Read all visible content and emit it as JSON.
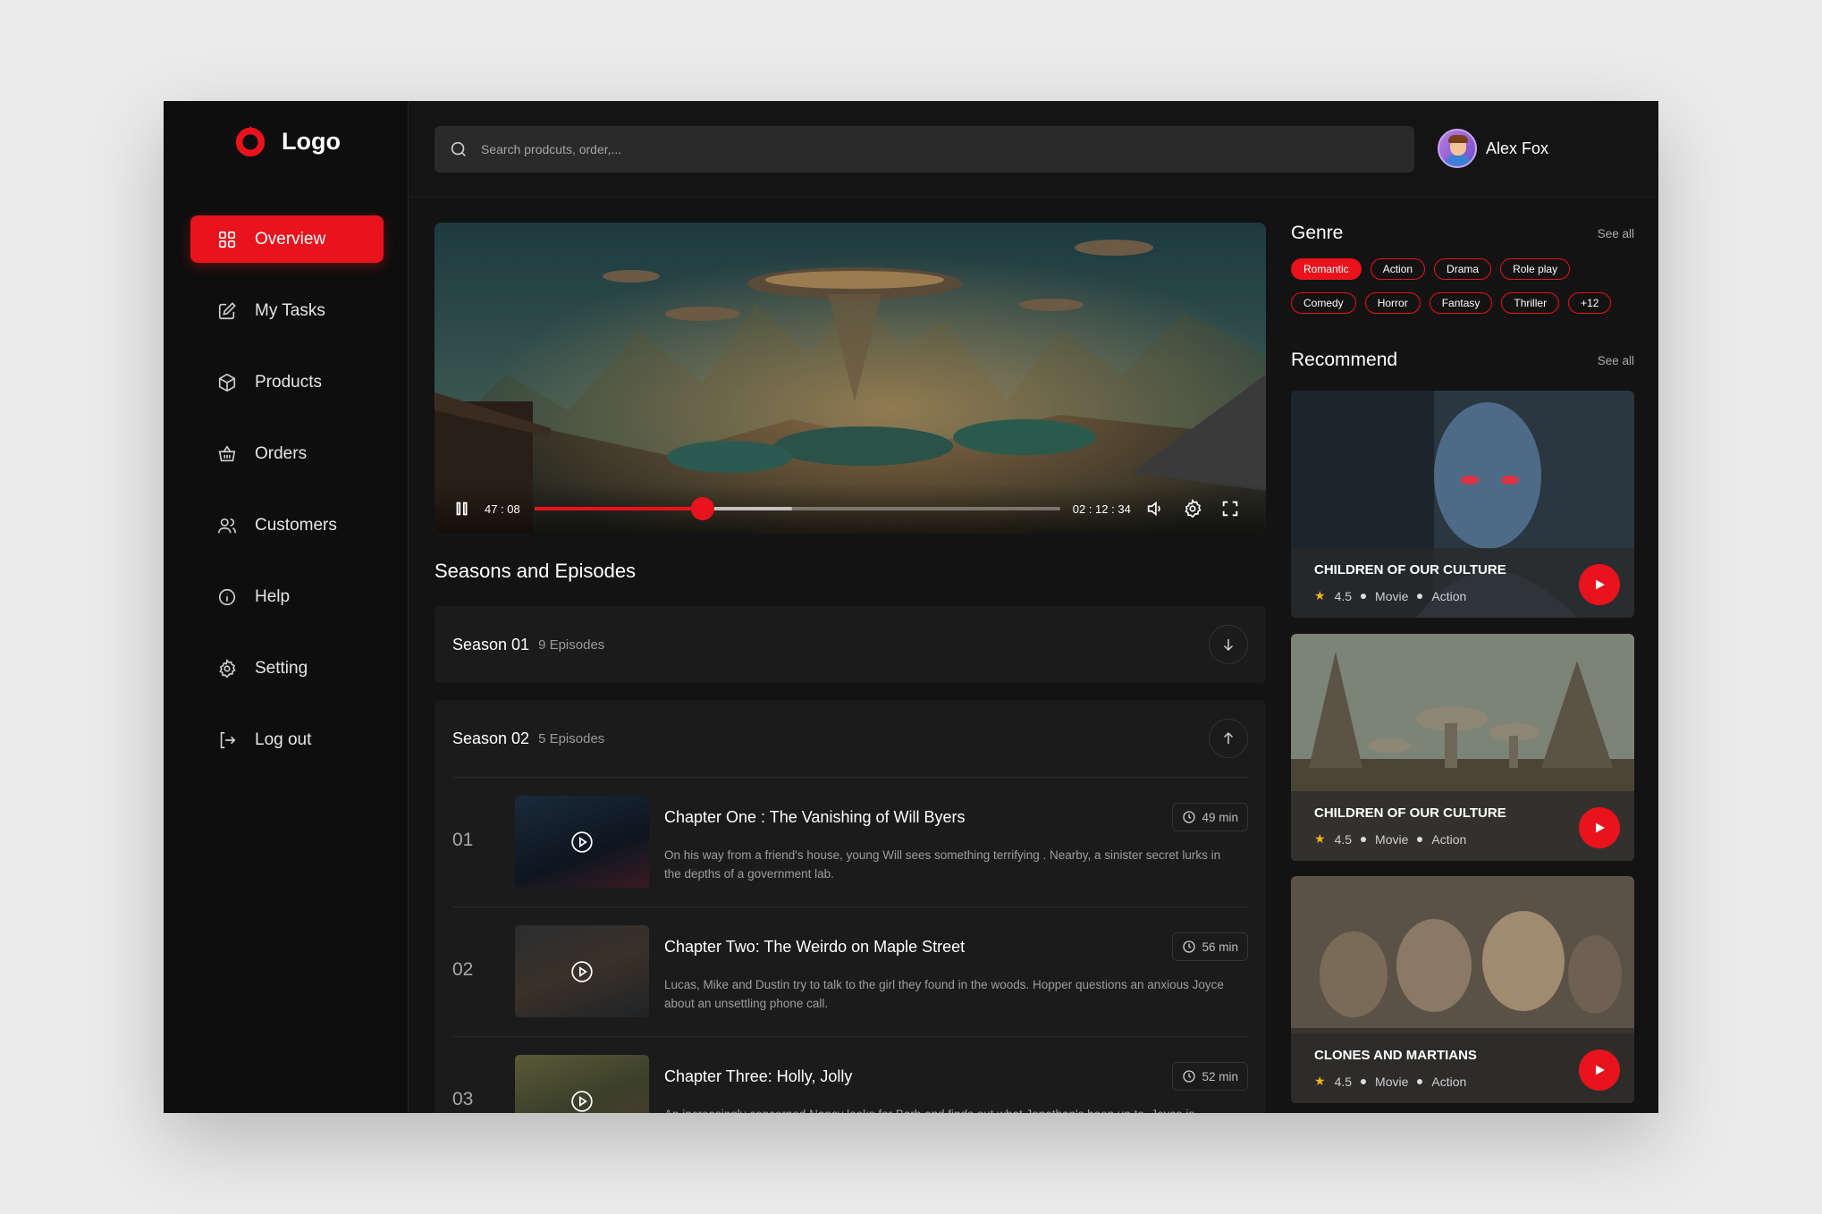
{
  "brand": {
    "logo_text": "Logo",
    "accent": "#e8131c"
  },
  "sidebar": {
    "items": [
      {
        "label": "Overview",
        "icon": "grid-icon",
        "active": true
      },
      {
        "label": "My Tasks",
        "icon": "edit-icon"
      },
      {
        "label": "Products",
        "icon": "box-icon"
      },
      {
        "label": "Orders",
        "icon": "basket-icon"
      },
      {
        "label": "Customers",
        "icon": "users-icon"
      },
      {
        "label": "Help",
        "icon": "info-icon"
      },
      {
        "label": "Setting",
        "icon": "gear-icon"
      },
      {
        "label": "Log out",
        "icon": "logout-icon"
      }
    ]
  },
  "header": {
    "search_placeholder": "Search prodcuts, order,...",
    "user_name": "Alex Fox"
  },
  "player": {
    "current_time": "47 : 08",
    "total_time": "02 : 12 : 34",
    "progress": 0.32,
    "buffered": 0.49
  },
  "seasons": {
    "title": "Seasons and Episodes",
    "list": [
      {
        "name": "Season 01",
        "count": "9 Episodes",
        "expanded": false
      },
      {
        "name": "Season 02",
        "count": "5 Episodes",
        "expanded": true
      }
    ],
    "episodes": [
      {
        "num": "01",
        "title": "Chapter One : The Vanishing of Will Byers",
        "desc": "On his way from a friend's house, young Will sees something terrifying . Nearby, a sinister secret lurks in the depths of a government lab.",
        "duration": "49 min"
      },
      {
        "num": "02",
        "title": "Chapter Two: The Weirdo on Maple Street",
        "desc": "Lucas, Mike and Dustin try to talk to the girl they found in the woods. Hopper questions an anxious Joyce about an unsettling phone call.",
        "duration": "56 min"
      },
      {
        "num": "03",
        "title": "Chapter Three: Holly, Jolly",
        "desc": "An increasingly concerned Nancy looks for Barb and finds out what Jonathan's been up to. Joyce is",
        "duration": "52 min"
      }
    ]
  },
  "genre": {
    "title": "Genre",
    "see_all": "See all",
    "chips": [
      "Romantic",
      "Action",
      "Drama",
      "Role play",
      "Comedy",
      "Horror",
      "Fantasy",
      "Thriller",
      "+12"
    ]
  },
  "recommend": {
    "title": "Recommend",
    "see_all": "See all",
    "items": [
      {
        "title": "CHILDREN OF OUR CULTURE",
        "rating": "4.5",
        "type": "Movie",
        "genre": "Action"
      },
      {
        "title": "CHILDREN OF OUR CULTURE",
        "rating": "4.5",
        "type": "Movie",
        "genre": "Action"
      },
      {
        "title": "CLONES AND MARTIANS",
        "rating": "4.5",
        "type": "Movie",
        "genre": "Action"
      }
    ]
  }
}
